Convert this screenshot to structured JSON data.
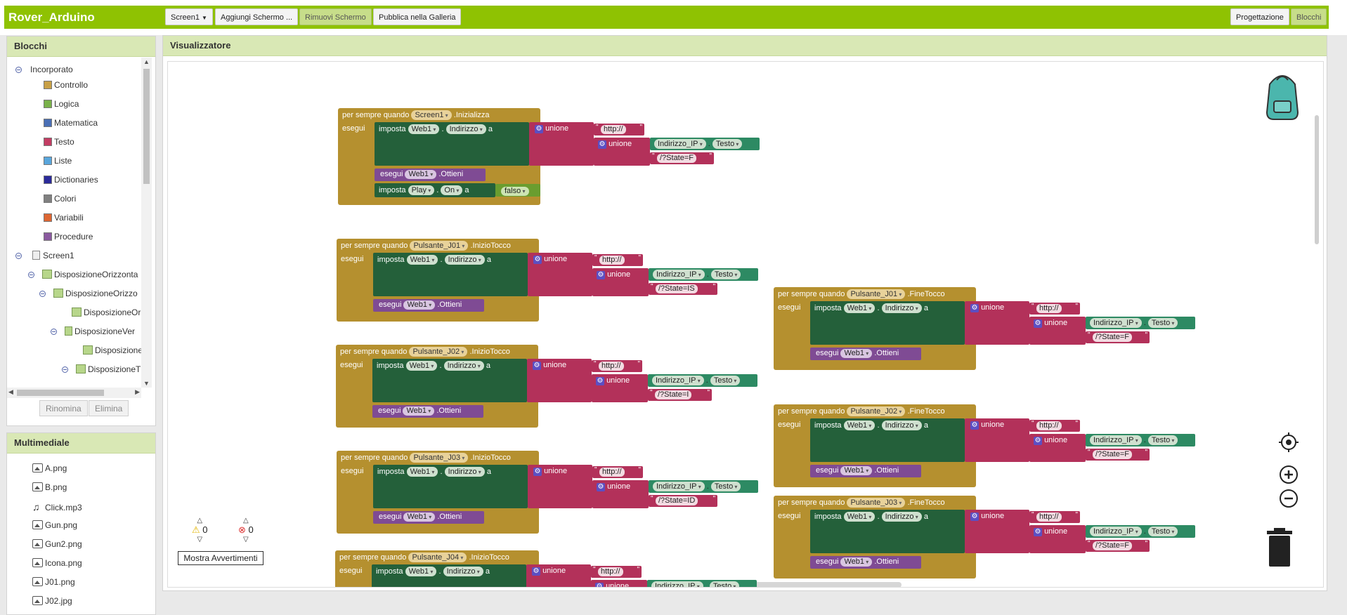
{
  "app": {
    "title": "Rover_Arduino"
  },
  "toolbar": {
    "screen_select": "Screen1",
    "add_screen": "Aggiungi Schermo ...",
    "remove_screen": "Rimuovi Schermo",
    "publish": "Pubblica nella Galleria",
    "designer": "Progettazione",
    "blocks": "Blocchi"
  },
  "blocks_panel": {
    "title": "Blocchi",
    "builtin": "Incorporato",
    "categories": [
      {
        "label": "Controllo",
        "color": "#c8a046"
      },
      {
        "label": "Logica",
        "color": "#79b14a"
      },
      {
        "label": "Matematica",
        "color": "#4a6fb5"
      },
      {
        "label": "Testo",
        "color": "#c33d63"
      },
      {
        "label": "Liste",
        "color": "#59a6dc"
      },
      {
        "label": "Dictionaries",
        "color": "#2b2a9a"
      },
      {
        "label": "Colori",
        "color": "#808080"
      },
      {
        "label": "Variabili",
        "color": "#dd6633"
      },
      {
        "label": "Procedure",
        "color": "#8a5a9f"
      }
    ],
    "screen": "Screen1",
    "components": [
      "DisposizioneOrizzonta",
      "DisposizioneOrizzo",
      "DisposizioneOriz",
      "DisposizioneVer",
      "Disposizione(",
      "DisposizioneT"
    ],
    "rename": "Rinomina",
    "delete": "Elimina"
  },
  "media_panel": {
    "title": "Multimediale",
    "files": [
      "A.png",
      "B.png",
      "Click.mp3",
      "Gun.png",
      "Gun2.png",
      "Icona.png",
      "J01.png",
      "J02.jpg"
    ]
  },
  "workspace": {
    "title": "Visualizzatore",
    "warnings_count": "0",
    "errors_count": "0",
    "show_warnings": "Mostra Avvertimenti"
  },
  "block_text": {
    "when": "per sempre quando",
    "do": "esegui",
    "set": "imposta",
    "to": "a",
    "dot": ".",
    "join": "unione",
    "web": "Web1",
    "url": "Indirizzo",
    "get": ".Ottieni",
    "http": "http://",
    "ip": "Indirizzo_IP",
    "text": "Testo",
    "play": "Play",
    "on": "On",
    "false": "falso"
  },
  "events": [
    {
      "comp": "Screen1",
      "event": ".Inizializza",
      "param": "/?State=F"
    },
    {
      "comp": "Pulsante_J01",
      "event": ".InizioTocco",
      "param": "/?State=IS"
    },
    {
      "comp": "Pulsante_J02",
      "event": ".InizioTocco",
      "param": "/?State=I"
    },
    {
      "comp": "Pulsante_J03",
      "event": ".InizioTocco",
      "param": "/?State=ID"
    },
    {
      "comp": "Pulsante_J04",
      "event": ".InizioTocco",
      "param": ""
    },
    {
      "comp": "Pulsante_J01",
      "event": ".FineTocco",
      "param": "/?State=F"
    },
    {
      "comp": "Pulsante_J02",
      "event": ".FineTocco",
      "param": "/?State=F"
    },
    {
      "comp": "Pulsante_J03",
      "event": ".FineTocco",
      "param": "/?State=F"
    }
  ]
}
